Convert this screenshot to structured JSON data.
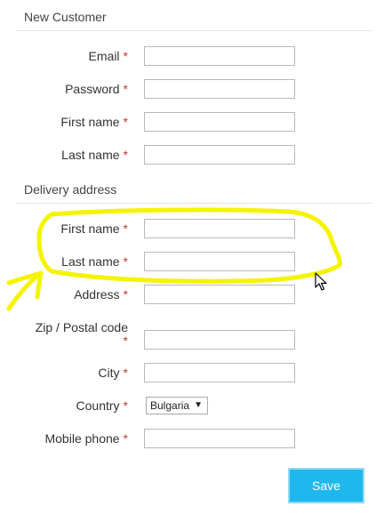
{
  "new_customer": {
    "title": "New Customer",
    "fields": [
      {
        "label": "Email",
        "required": "*",
        "value": ""
      },
      {
        "label": "Password",
        "required": "*",
        "value": ""
      },
      {
        "label": "First name",
        "required": "*",
        "value": ""
      },
      {
        "label": "Last name",
        "required": "*",
        "value": ""
      }
    ]
  },
  "delivery": {
    "title": "Delivery address",
    "fields": [
      {
        "label": "First name",
        "required": "*",
        "value": ""
      },
      {
        "label": "Last name",
        "required": "*",
        "value": ""
      },
      {
        "label": "Address",
        "required": "*",
        "value": ""
      },
      {
        "label": "Zip / Postal code",
        "required": "*",
        "value": ""
      },
      {
        "label": "City",
        "required": "*",
        "value": ""
      },
      {
        "label": "Country",
        "required": "*",
        "selected": "Bulgaria"
      },
      {
        "label": "Mobile phone",
        "required": "*",
        "value": ""
      }
    ]
  },
  "save_label": "Save",
  "colors": {
    "required": "#c0392b",
    "button": "#1fb8ec",
    "highlight": "#f4f400"
  },
  "icons": {
    "cursor": "mouse-pointer-icon",
    "annotation": "hand-drawn-highlight-arrow"
  }
}
